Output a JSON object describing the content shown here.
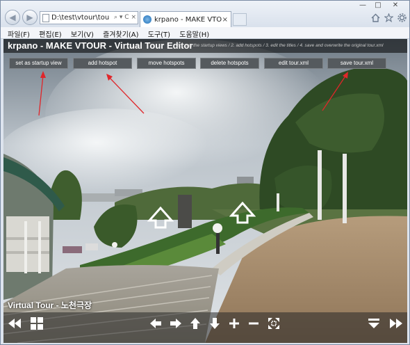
{
  "browser": {
    "address_url": "D:\\test\\vtour\\tou",
    "address_tools": "⌕ ▾ C ×",
    "tab_title": "krpano - MAKE VTOUR - V...",
    "tab_close": "×",
    "window_buttons": [
      "—",
      "□",
      "✕"
    ],
    "icons": [
      "home-icon",
      "star-icon",
      "gear-icon"
    ]
  },
  "menu": {
    "items": [
      "파일(F)",
      "편집(E)",
      "보기(V)",
      "즐겨찾기(A)",
      "도구(T)",
      "도움말(H)"
    ]
  },
  "editor": {
    "title": "krpano - MAKE VTOUR - Virtual Tour Editor",
    "hint": "// 1. set the startup views / 2. add hotspots / 3. edit the titles / 4. save and overwrite the original tour.xml",
    "buttons": [
      "set as startup view",
      "add hotspot",
      "move hotspots",
      "delete hotspots",
      "edit tour.xml",
      "save tour.xml"
    ]
  },
  "tour": {
    "name": "Virtual Tour - 노천극장"
  },
  "controls": {
    "icons": [
      "hide-thumbs-icon",
      "thumbnails-icon",
      "left-icon",
      "right-icon",
      "up-icon",
      "down-icon",
      "zoom-in-icon",
      "zoom-out-icon",
      "fullscreen-icon",
      "menu-down-icon",
      "next-icon"
    ]
  },
  "colors": {
    "title_bg": "#000000",
    "button_bg": "#555a5e",
    "arrow_red": "#e0262a"
  }
}
